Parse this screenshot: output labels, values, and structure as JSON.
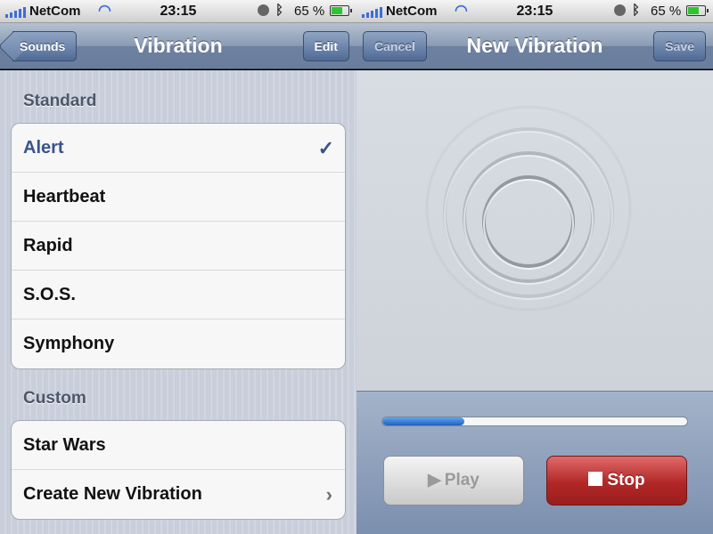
{
  "left": {
    "status": {
      "carrier": "NetCom",
      "time": "23:15",
      "battery_pct": "65 %"
    },
    "nav": {
      "back_label": "Sounds",
      "title": "Vibration",
      "edit_label": "Edit"
    },
    "standard": {
      "header": "Standard",
      "items": [
        {
          "label": "Alert",
          "selected": true
        },
        {
          "label": "Heartbeat"
        },
        {
          "label": "Rapid"
        },
        {
          "label": "S.O.S."
        },
        {
          "label": "Symphony"
        }
      ]
    },
    "custom": {
      "header": "Custom",
      "items": [
        {
          "label": "Star Wars"
        },
        {
          "label": "Create New Vibration"
        }
      ]
    },
    "check_glyph": "✓",
    "chevron_glyph": "›"
  },
  "right": {
    "status": {
      "carrier": "NetCom",
      "time": "23:15",
      "battery_pct": "65 %"
    },
    "nav": {
      "cancel_label": "Cancel",
      "title": "New Vibration",
      "save_label": "Save"
    },
    "progress": 0.27,
    "play_label": "Play",
    "play_glyph": "▶",
    "stop_label": "Stop"
  },
  "colors": {
    "accent": "#3a5488",
    "stop": "#b22727",
    "progress": "#1f5fbf"
  }
}
